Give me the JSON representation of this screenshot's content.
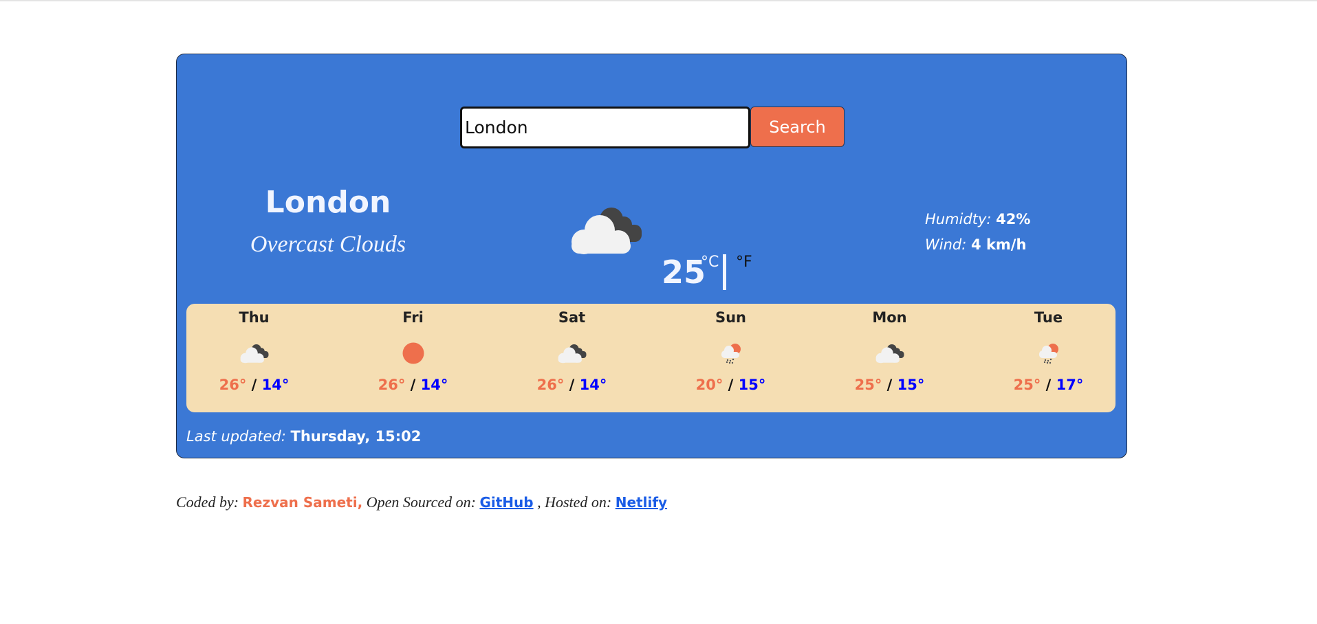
{
  "search": {
    "value": "London",
    "button_label": "Search"
  },
  "current": {
    "city": "London",
    "description": "Overcast Clouds",
    "icon": "overcast-clouds-icon",
    "temperature": "25",
    "unit_c": "°C",
    "unit_f": "°F",
    "humidity_label": "Humidty:",
    "humidity_value": "42%",
    "wind_label": "Wind:",
    "wind_value": "4 km/h"
  },
  "forecast": [
    {
      "day": "Thu",
      "icon": "overcast-clouds",
      "max": "26°",
      "min": "14°"
    },
    {
      "day": "Fri",
      "icon": "clear-sun",
      "max": "26°",
      "min": "14°"
    },
    {
      "day": "Sat",
      "icon": "overcast-clouds",
      "max": "26°",
      "min": "14°"
    },
    {
      "day": "Sun",
      "icon": "rain-sun",
      "max": "20°",
      "min": "15°"
    },
    {
      "day": "Mon",
      "icon": "overcast-clouds",
      "max": "25°",
      "min": "15°"
    },
    {
      "day": "Tue",
      "icon": "rain-sun",
      "max": "25°",
      "min": "17°"
    }
  ],
  "updated": {
    "label": "Last updated:",
    "value": "Thursday, 15:02"
  },
  "footer": {
    "coded_by": "Coded by:",
    "author": "Rezvan Sameti,",
    "open_sourced": "Open Sourced on:",
    "github": "GitHub",
    "hosted": ", Hosted on:",
    "netlify": "Netlify"
  },
  "colors": {
    "card": "#3b78d5",
    "accent": "#ee6f4c",
    "forecast_bg": "#f5deb3",
    "low_temp": "#0000ff",
    "link": "#1a5ce6"
  }
}
